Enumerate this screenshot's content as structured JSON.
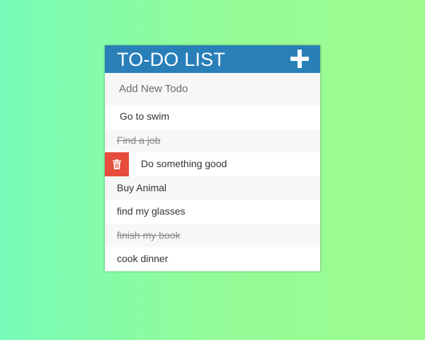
{
  "header": {
    "title": "TO-DO LIST",
    "add_icon": "plus-icon"
  },
  "new_todo": {
    "placeholder": "Add New Todo",
    "value": ""
  },
  "todos": [
    {
      "text": "Go to swim",
      "completed": false
    },
    {
      "text": "Find a job",
      "completed": true
    },
    {
      "text": "Do something good",
      "completed": false,
      "hovered": true,
      "delete_icon": "trash-icon"
    },
    {
      "text": "Buy Animal",
      "completed": false
    },
    {
      "text": "find my glasses",
      "completed": false
    },
    {
      "text": "finish my book",
      "completed": true
    },
    {
      "text": "cook dinner",
      "completed": false
    }
  ],
  "colors": {
    "header_bg": "#2980b9",
    "delete_bg": "#e74c3c",
    "background_start": "#77fcb9",
    "background_end": "#9efb8e"
  }
}
